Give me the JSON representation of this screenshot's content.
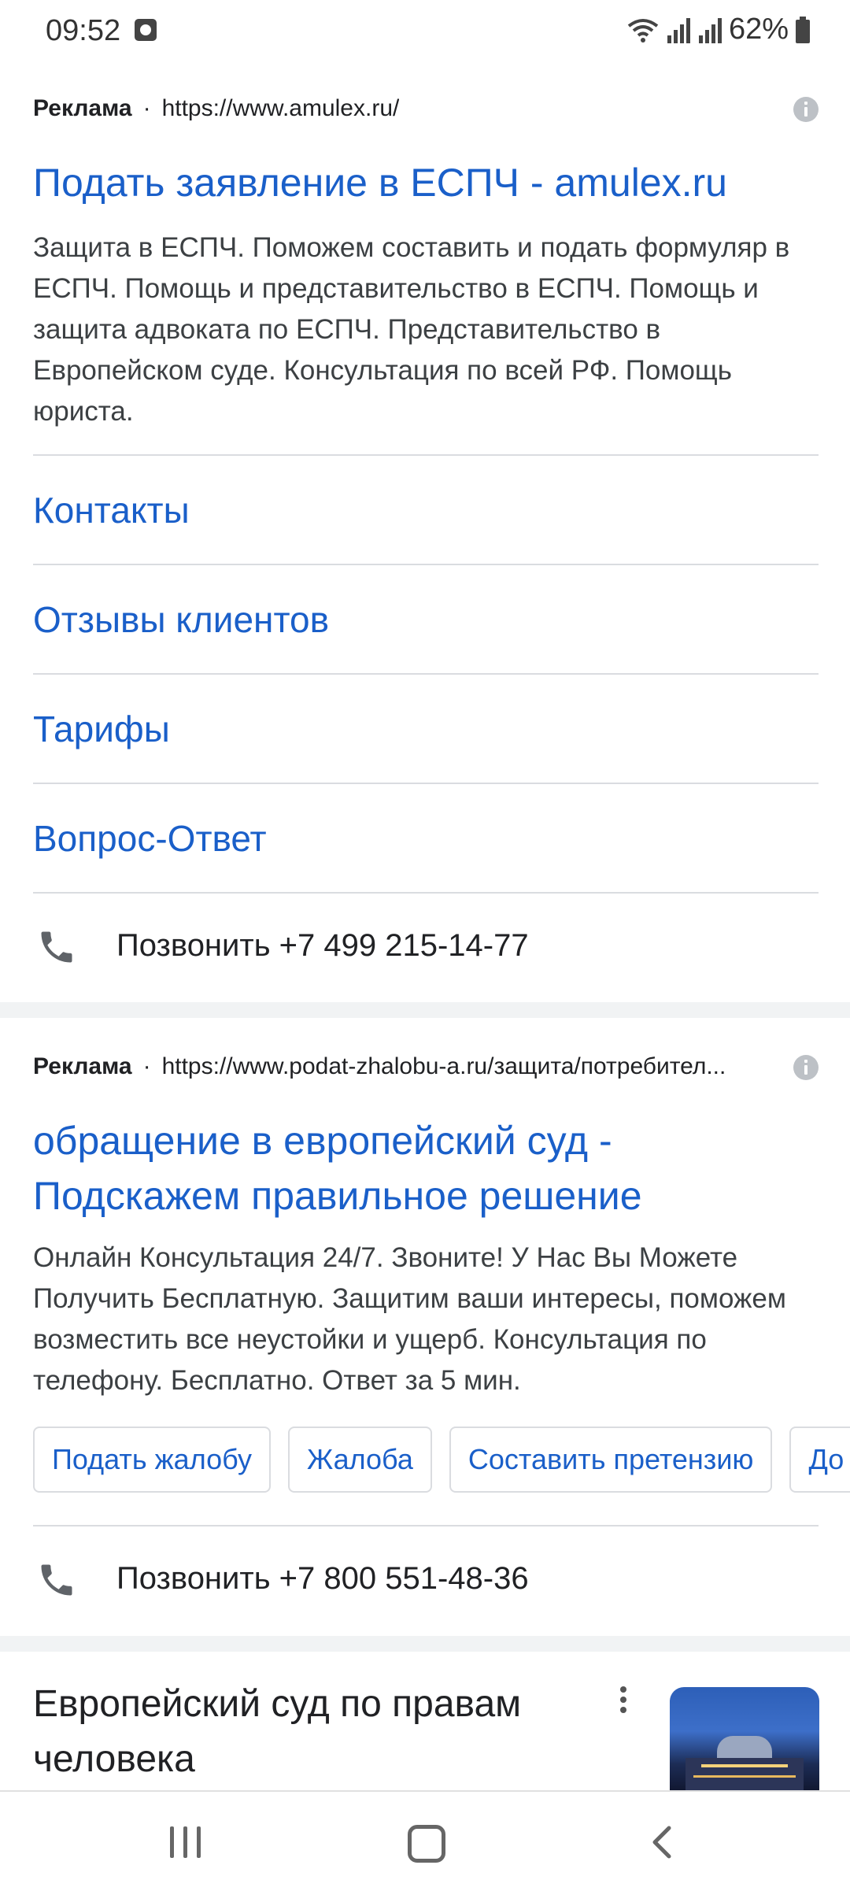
{
  "status_bar": {
    "time": "09:52",
    "battery": "62%",
    "icons": [
      "media-icon",
      "wifi-icon",
      "signal-icon",
      "signal-icon",
      "battery-icon"
    ]
  },
  "ads": [
    {
      "label": "Реклама",
      "separator": "·",
      "url": "https://www.amulex.ru/",
      "title": "Подать заявление в ЕСПЧ - amulex.ru",
      "description": "Защита в ЕСПЧ. Поможем составить и подать формуляр в ЕСПЧ. Помощь и представительство в ЕСПЧ. Помощь и защита адвоката по ЕСПЧ. Представительство в Европейском суде. Консультация по всей РФ. Помощь юриста.",
      "sitelinks": [
        "Контакты",
        "Отзывы клиентов",
        "Тарифы",
        "Вопрос-Ответ"
      ],
      "call": "Позвонить +7 499 215-14-77"
    },
    {
      "label": "Реклама",
      "separator": "·",
      "url": "https://www.podat-zhalobu-a.ru/защита/потребител...",
      "title": "обращение в европейский суд - Подскажем правильное решение",
      "description": "Онлайн Консультация 24/7. Звоните! У Нас Вы Можете Получить Бесплатную. Защитим ваши интересы, поможем возместить все неустойки и ущерб. Консультация по телефону. Бесплатно. Ответ за 5 мин.",
      "chips": [
        "Подать жалобу",
        "Жалоба",
        "Составить претензию",
        "До"
      ],
      "call": "Позвонить +7 800 551-48-36"
    }
  ],
  "knowledge_card": {
    "title": "Европейский суд по правам человека"
  },
  "colors": {
    "link": "#1a5fc9",
    "text": "#202124",
    "divider": "#dadce0"
  }
}
